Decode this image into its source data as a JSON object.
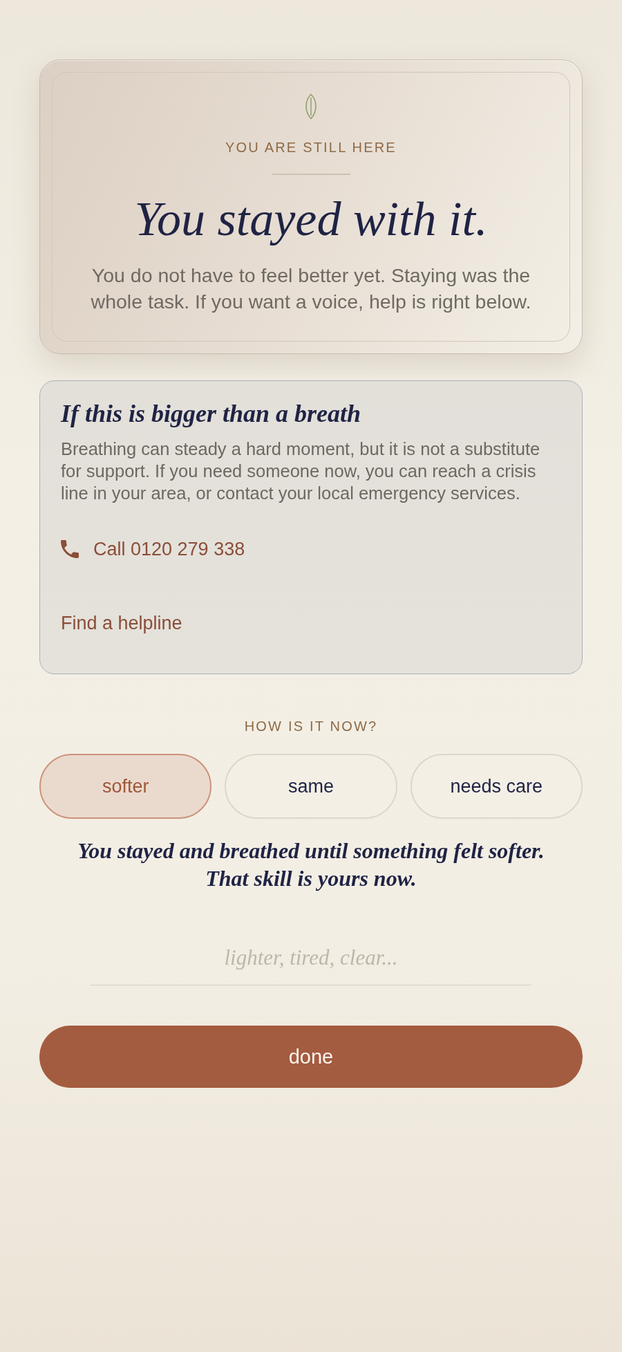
{
  "summary_card": {
    "eyebrow": "YOU ARE STILL HERE",
    "title": "You stayed with it.",
    "message": "You do not have to feel better yet. Staying was the whole task. If you want a voice, help is right below."
  },
  "support_card": {
    "title": "If this is bigger than a breath",
    "body": "Breathing can steady a hard moment, but it is not a substitute for support. If you need someone now, you can reach a crisis line in your area, or contact your local emergency services.",
    "call_link": "Call 0120 279 338",
    "helpline_link": "Find a helpline"
  },
  "check_in": {
    "question": "HOW IS IT NOW?",
    "options": [
      {
        "label": "softer",
        "selected": true
      },
      {
        "label": "same",
        "selected": false
      },
      {
        "label": "needs care",
        "selected": false
      }
    ],
    "reflection": "You stayed and breathed until something felt softer. That skill is yours now.",
    "feeling_field": {
      "placeholder": "lighter, tired, clear..."
    }
  },
  "done_button": "done"
}
